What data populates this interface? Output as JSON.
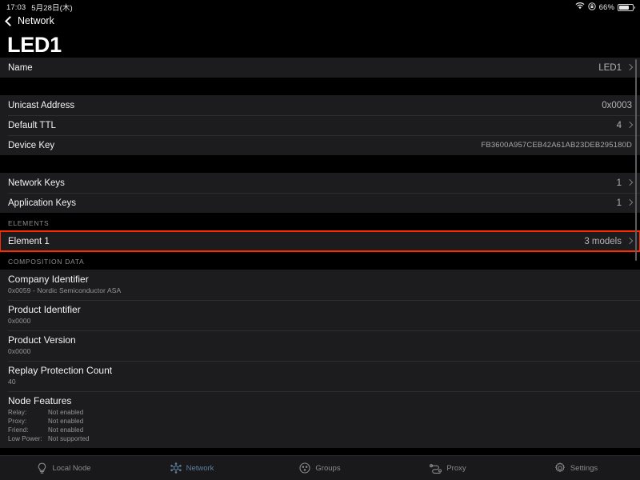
{
  "status_bar": {
    "time": "17:03",
    "date": "5月28日(木)",
    "battery_percent": "66%",
    "wifi_icon": "wifi-icon",
    "rotation_lock_icon": "rotation-lock-icon",
    "battery_icon": "battery-icon"
  },
  "nav": {
    "back_label": "Network",
    "back_icon": "chevron-left-icon",
    "title": "LED1"
  },
  "sections": {
    "name_group": [
      {
        "label": "Name",
        "value": "LED1",
        "chevron": true
      }
    ],
    "address_group": [
      {
        "label": "Unicast Address",
        "value": "0x0003",
        "chevron": false
      },
      {
        "label": "Default TTL",
        "value": "4",
        "chevron": true
      },
      {
        "label": "Device Key",
        "value": "FB3600A957CEB42A61AB23DEB295180D",
        "chevron": false,
        "mono": true
      }
    ],
    "keys_group": [
      {
        "label": "Network Keys",
        "value": "1",
        "chevron": true
      },
      {
        "label": "Application Keys",
        "value": "1",
        "chevron": true
      }
    ],
    "elements": {
      "header": "ELEMENTS",
      "rows": [
        {
          "label": "Element 1",
          "value": "3 models",
          "chevron": true,
          "highlighted": true
        }
      ]
    },
    "composition": {
      "header": "COMPOSITION DATA",
      "rows": [
        {
          "label": "Company Identifier",
          "sub": "0x0059 - Nordic Semiconductor ASA"
        },
        {
          "label": "Product Identifier",
          "sub": "0x0000"
        },
        {
          "label": "Product Version",
          "sub": "0x0000"
        },
        {
          "label": "Replay Protection Count",
          "sub": "40"
        }
      ],
      "node_features": {
        "label": "Node Features",
        "items": [
          {
            "key": "Relay:",
            "value": "Not enabled"
          },
          {
            "key": "Proxy:",
            "value": "Not enabled"
          },
          {
            "key": "Friend:",
            "value": "Not enabled"
          },
          {
            "key": "Low Power:",
            "value": "Not supported"
          }
        ]
      }
    }
  },
  "tab_bar": {
    "active": "Network",
    "active_color": "#5f7f9e",
    "inactive_color": "#8a8a90",
    "tabs": [
      {
        "label": "Local Node",
        "icon": "lightbulb-icon"
      },
      {
        "label": "Network",
        "icon": "network-node-icon"
      },
      {
        "label": "Groups",
        "icon": "groups-circle-icon"
      },
      {
        "label": "Proxy",
        "icon": "proxy-link-icon"
      },
      {
        "label": "Settings",
        "icon": "gear-icon"
      }
    ]
  },
  "annotation": {
    "highlight_color": "#ff2a00",
    "target": "Element 1"
  }
}
